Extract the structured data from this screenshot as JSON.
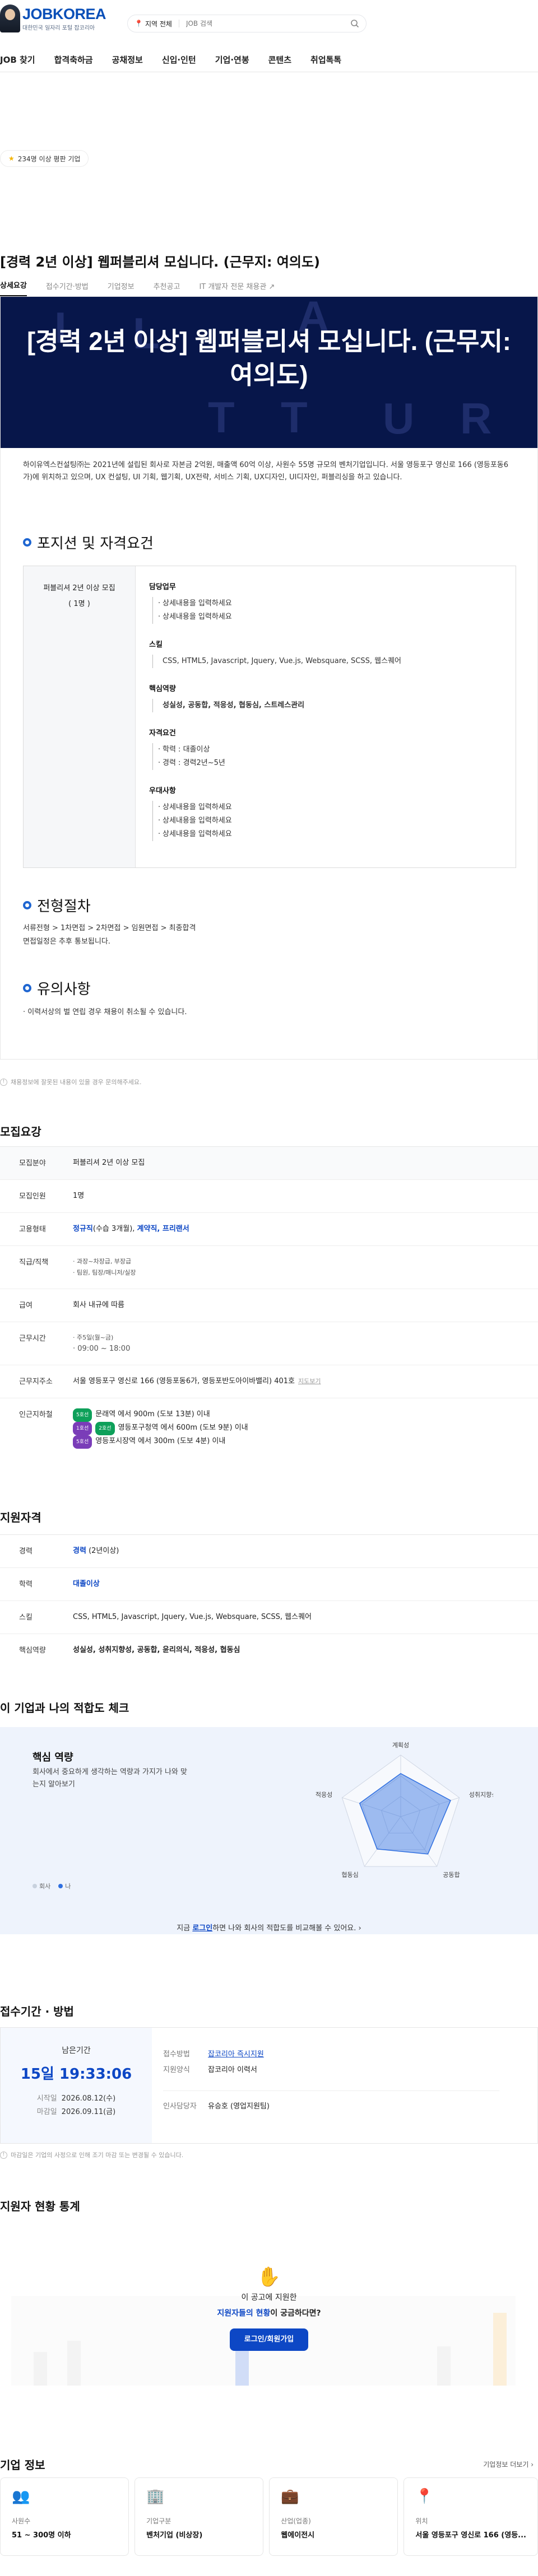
{
  "header": {
    "logo": "JOBKOREA",
    "logo_sub": "대한민국 일자리 포털 잡코리아",
    "search_region": "지역 전체",
    "search_placeholder": "JOB 검색",
    "nav": [
      "JOB 찾기",
      "합격축하금",
      "공채정보",
      "신입·인턴",
      "기업·연봉",
      "콘텐츠",
      "취업톡톡"
    ]
  },
  "badge": "234명 이상 평판 기업",
  "job": {
    "title": "[경력 2년 이상] 웹퍼블리셔 모십니다. (근무지: 여의도)",
    "tabs": [
      "상세요강",
      "접수기간·방법",
      "기업정보",
      "추천공고",
      "IT 개발자 전문 채용관"
    ]
  },
  "detail": {
    "banner_title": "[경력 2년 이상] 웹퍼블리셔 모십니다. (근무지: 여의도)",
    "banner_letters": [
      "I",
      "T",
      "A",
      "T",
      "U",
      "R",
      "L"
    ],
    "intro": "하이유엑스컨설팅㈜는 2021년에 설립된 회사로 자본금 2억원, 매출액 60억 이상, 사원수 55명 규모의 벤처기업입니다. 서울 영등포구 영신로 166 (영등포동6가)에 위치하고 있으며, UX 컨설팅, UI 기획, 웹기획, UX전략, 서비스 기획, UX디자인, UI디자인, 퍼블리싱을 하고 있습니다.",
    "section_position": "포지션 및 자격요건",
    "position_name": "퍼블리셔 2년 이상 모집",
    "position_count": "( 1명 )",
    "groups": [
      {
        "title": "담당업무",
        "lines": [
          "상세내용을 입력하세요",
          "상세내용을 입력하세요"
        ],
        "bullet": true
      },
      {
        "title": "스킬",
        "lines": [
          "CSS, HTML5, Javascript, Jquery, Vue.js, Websquare, SCSS, 웹스퀘어"
        ],
        "bullet": false
      },
      {
        "title": "핵심역량",
        "lines": [
          "성실성, 공동합, 적응성, 협동심, 스트레스관리"
        ],
        "bullet": false
      },
      {
        "title": "자격요건",
        "lines": [
          "학력 : 대졸이상",
          "경력 : 경력2년~5년"
        ],
        "bullet": true
      },
      {
        "title": "우대사항",
        "lines": [
          "상세내용을 입력하세요",
          "상세내용을 입력하세요",
          "상세내용을 입력하세요"
        ],
        "bullet": true
      }
    ],
    "section_process": "전형절차",
    "process_steps": "서류전형 > 1차면접 > 2차면접 > 임원면접 > 최종합격",
    "process_note": "면접일정은 추후 통보됩니다.",
    "section_caution": "유의사항",
    "caution_text": "· 이력서상의 벌 연립 경우 채용이 취소될 수 있습니다."
  },
  "detail_notice": "채용정보에 잘못된 내용이 있을 경우 문의해주세요.",
  "recruit": {
    "title": "모집요강",
    "rows": {
      "field_k": "모집분야",
      "field_v": "퍼블리셔 2년 이상 모집",
      "count_k": "모집인원",
      "count_v": "1명",
      "type_k": "고용형태",
      "type_v1": "정규직",
      "type_v1b": "(수습 3개월)",
      "type_v2": "계약직, 프리랜서",
      "rank_k": "직급/직책",
      "rank_l1": "과장~차장급, 부장급",
      "rank_l2": "팀원, 팀장/매니저/실장",
      "pay_k": "급여",
      "pay_v": "회사 내규에 따름",
      "time_k": "근무시간",
      "time_l1": "주5일(월~금)",
      "time_l2": "09:00 ~ 18:00",
      "addr_k": "근무지주소",
      "addr_v": "서울 영등포구 영신로 166 (영등포동6가, 영등포반도아이바밸리) 401호",
      "addr_map": "지도보기",
      "subway_k": "인근지하철",
      "subway": [
        {
          "tag": "5호선",
          "text": "문래역 에서 900m (도보 13분) 이내",
          "color": "#0ea05a"
        },
        {
          "tag": "1호선",
          "text": "영등포구청역 에서 600m (도보 9분) 이내",
          "color": "#7a3db8"
        },
        {
          "tag": "5호선",
          "text": "영등포시장역 에서 300m (도보 4분) 이내",
          "color": "#7a3db8"
        }
      ],
      "subway_tag_b": "2호선"
    }
  },
  "qualify": {
    "title": "지원자격",
    "career_k": "경력",
    "career_v": "경력",
    "career_v2": "(2년이상)",
    "edu_k": "학력",
    "edu_v": "대졸이상",
    "skill_k": "스킬",
    "skill_v": "CSS, HTML5, Javascript, Jquery, Vue.js, Websquare, SCSS, 웹스퀘어",
    "core_k": "핵심역량",
    "core_v": "성실성, 성취지향성, 공동합, 윤리의식, 적응성, 협동심"
  },
  "fit": {
    "title": "이 기업과 나의 적합도 체크",
    "card_title": "핵심 역량",
    "card_desc": "회사에서 중요하게 생각하는 역량과 가지가 나와 맞는지 알아보기",
    "legend_company": "회사",
    "legend_me": "나",
    "axes": [
      "계획성",
      "성취지향성",
      "공동합",
      "협동심",
      "적응성"
    ],
    "company_scores": [
      0.7,
      0.85,
      0.75,
      0.65,
      0.7
    ],
    "login_pre": "지금",
    "login_link": "로그인",
    "login_post": "하면 나와 회사의 적합도를 비교해볼 수 있어요."
  },
  "period": {
    "title": "접수기간 · 방법",
    "remain_label": "남은기간",
    "remain_time": "15일 19:33:06",
    "start_k": "시작일",
    "start_v": "2026.08.12(수)",
    "end_k": "마감일",
    "end_v": "2026.09.11(금)",
    "method_k": "접수방법",
    "method_v": "잡코리아 즉시지원",
    "form_k": "지원양식",
    "form_v": "잡코리아 이력서",
    "manager_k": "인사담당자",
    "manager_v": "유승호 (영업지원팀)",
    "notice": "마감일은 기업의 사정으로 인해 조기 마감 또는 변경될 수 있습니다."
  },
  "stats": {
    "title": "지원자 현황 통계",
    "line1": "이 공고에 지원한",
    "line2_blue": "지원자들의 현황",
    "line2_post": "이 궁금하다면?",
    "button": "로그인/회원가입"
  },
  "company": {
    "title": "기업 정보",
    "more": "기업정보 더보기",
    "cards": [
      {
        "icon": "👥",
        "label": "사원수",
        "value": "51 ~ 300명 이하"
      },
      {
        "icon": "🏢",
        "label": "기업구분",
        "value": "벤처기업 (비상장)"
      },
      {
        "icon": "💼",
        "label": "산업(업종)",
        "value": "웹에이전시"
      },
      {
        "icon": "📍",
        "label": "위치",
        "value": "서울 영등포구 영신로 166 (영등..."
      }
    ]
  }
}
